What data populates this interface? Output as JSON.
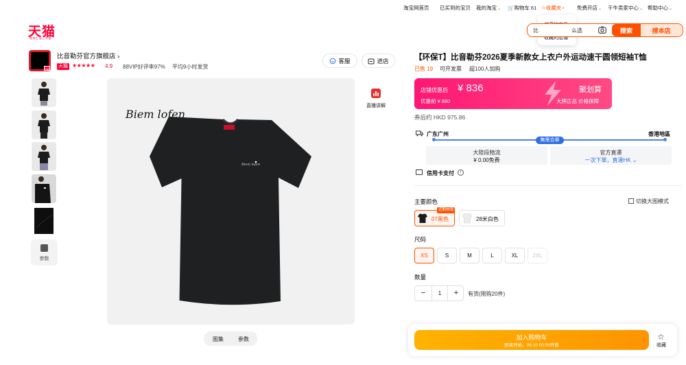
{
  "topnav": {
    "home": "淘宝网首页",
    "bought": "已买到的宝贝",
    "my_taobao": "我的淘宝",
    "cart": "购物车 61",
    "favorites": "收藏夹",
    "open_shop": "免费开店",
    "seller_center": "千牛卖家中心",
    "help": "帮助中心"
  },
  "fav_dropdown": {
    "items": [
      "收藏的宝贝",
      "收藏的店铺"
    ]
  },
  "logo": {
    "text": "天猫",
    "sub": "理想生活上天猫"
  },
  "search": {
    "query": "比",
    "query_suffix": "么选",
    "search_label": "搜索",
    "store_label": "搜本店"
  },
  "store": {
    "name": "比音勒芬官方旗舰店",
    "badge": "天猫",
    "stars": "★★★★★",
    "rating": "4.9",
    "vip": "88VIP好评率97%",
    "ship_time": "平均9小时发货",
    "service_label": "客服",
    "enter_label": "进店"
  },
  "thumbs": {
    "param_label": "参数"
  },
  "main_image": {
    "brand_text": "Biem lofen"
  },
  "live": {
    "label": "直播讲解"
  },
  "view_toggle": {
    "gallery": "图集",
    "params": "参数"
  },
  "product": {
    "title": "【环保T】比音勒芬2026夏季新款女上衣户外运动速干圆领短袖T恤",
    "sold": "已售 19",
    "invoice": "可开发票",
    "fav_count": "超100人加购"
  },
  "promo": {
    "coupon_label": "店铺优惠后",
    "price": "¥ 836",
    "pre_label": "优惠前 ¥ 880",
    "campaign": "聚划算",
    "guarantee": "大牌正品 价格保障"
  },
  "after_tax": "券后约 HKD 975.86",
  "shipping": {
    "from": "广东广州",
    "to": "香港地區",
    "badge": "無需合單",
    "card1_l1": "大陸段物流",
    "card1_l2": "¥ 0.00免费",
    "card2_l1": "官方直運",
    "card2_l2a": "一次下單，",
    "card2_l2b": "直達HK",
    "credit": "信用卡支付"
  },
  "color": {
    "label": "主要颜色",
    "switch_view": "切换大图模式",
    "limited_tag": "近期热销",
    "options": [
      "07黑色",
      "28米白色"
    ]
  },
  "size": {
    "label": "尺码",
    "options": [
      "XS",
      "S",
      "M",
      "L",
      "XL",
      "2XL"
    ]
  },
  "quantity": {
    "label": "数量",
    "value": "1",
    "minus": "−",
    "plus": "+",
    "stock": "有货(限购20件)"
  },
  "cart_button": {
    "label": "加入购物车",
    "sub": "即将开始，06.10 00:00开售"
  },
  "favorite": {
    "label": "收藏"
  },
  "colors": {
    "accent": "#ff5000",
    "tmall_red": "#ff0036",
    "promo": "#ff1673",
    "link_blue": "#2f6fe6"
  }
}
